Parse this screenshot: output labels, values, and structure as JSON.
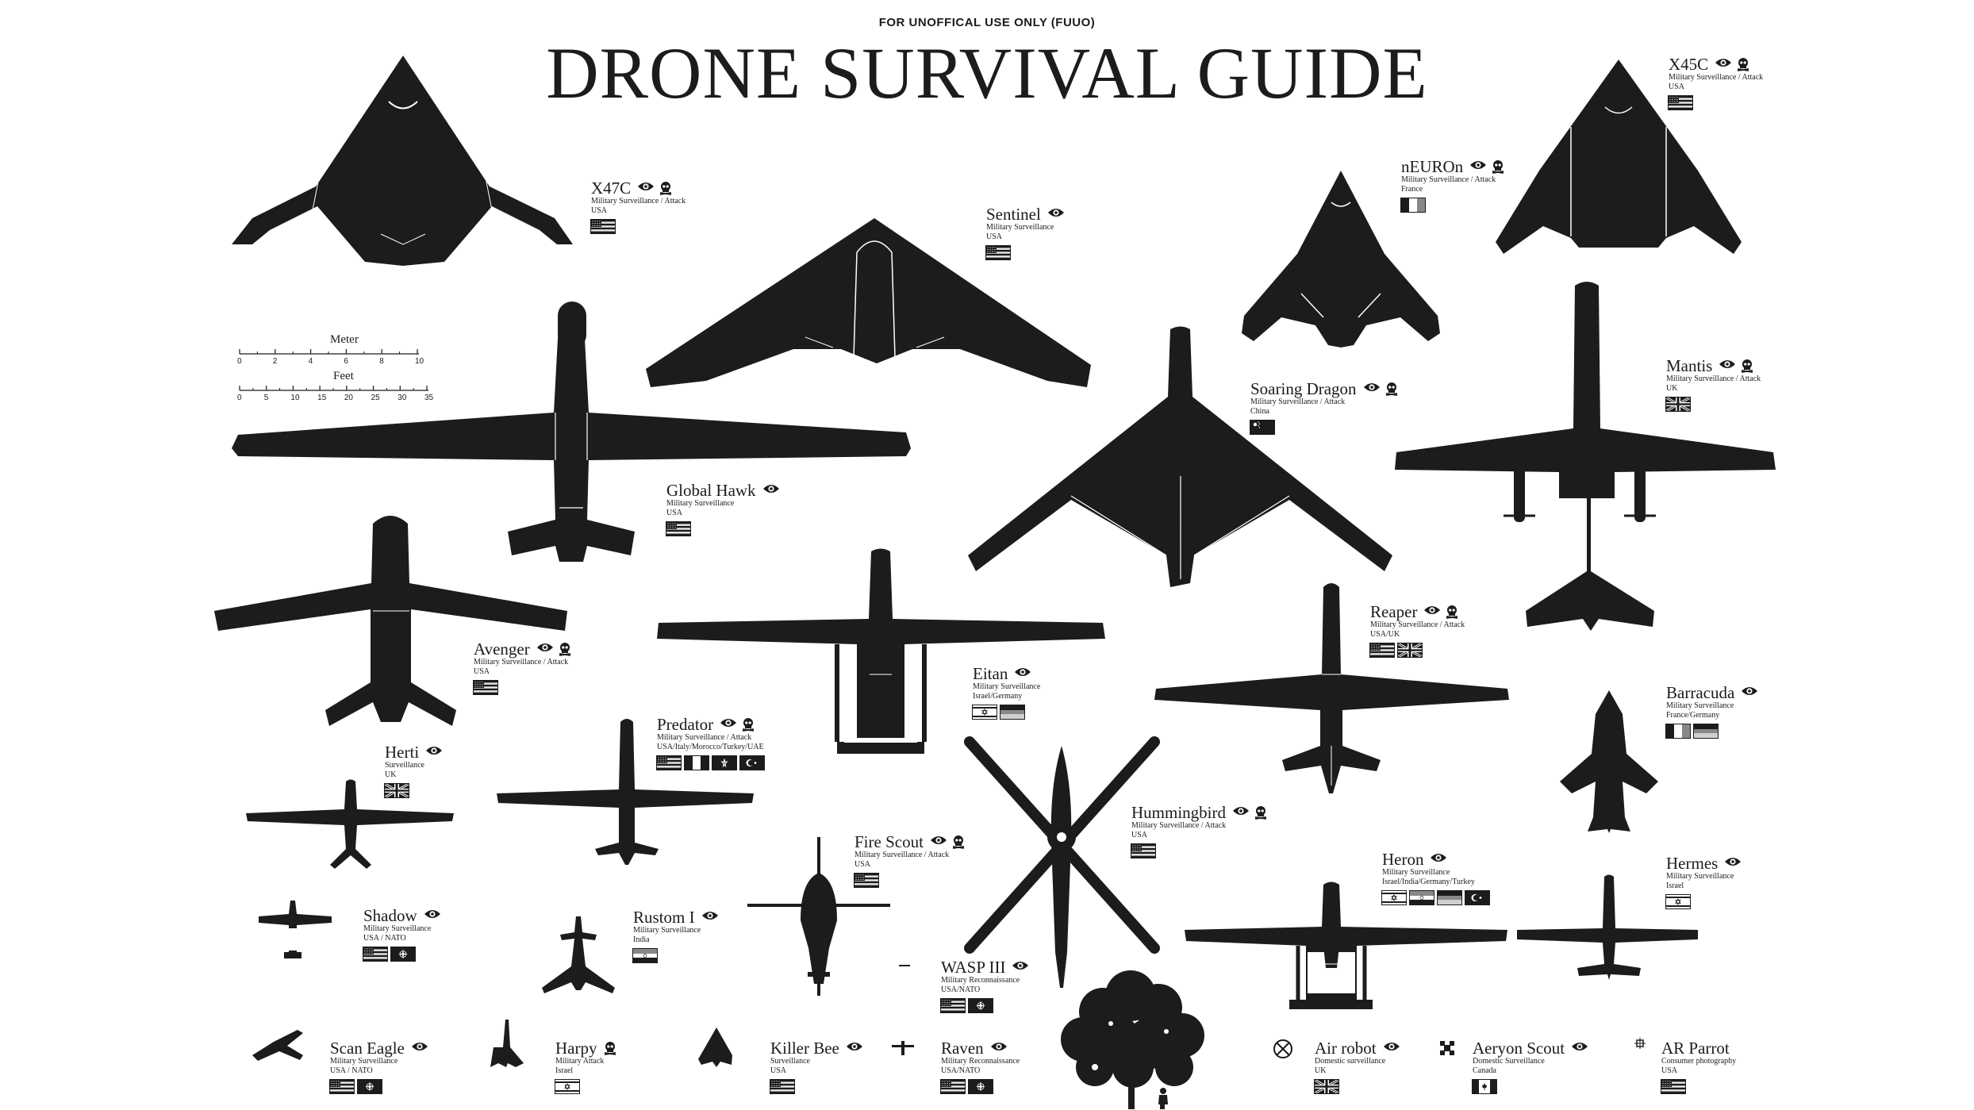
{
  "header": {
    "notice": "FOR UNOFFICAL USE ONLY (FUUO)",
    "title": "DRONE SURVIVAL GUIDE"
  },
  "colors": {
    "ink": "#1d1b1b",
    "paper": "#ffffff"
  },
  "scale": {
    "meter_label": "Meter",
    "meter_ticks": [
      "0",
      "2",
      "4",
      "6",
      "8",
      "10"
    ],
    "feet_label": "Feet",
    "feet_ticks": [
      "0",
      "5",
      "10",
      "15",
      "20",
      "25",
      "30",
      "35"
    ]
  },
  "legend_icons": {
    "surveillance": "eye-icon",
    "attack": "skull-icon"
  },
  "drones": [
    {
      "key": "x47c",
      "name": "X47C",
      "type": "Military Surveillance / Attack",
      "country": "USA",
      "icons": [
        "eye-icon",
        "skull-icon"
      ],
      "flags": [
        "usa"
      ]
    },
    {
      "key": "sentinel",
      "name": "Sentinel",
      "type": "Military Surveillance",
      "country": "USA",
      "icons": [
        "eye-icon"
      ],
      "flags": [
        "usa"
      ]
    },
    {
      "key": "neuron",
      "name": "nEUROn",
      "type": "Military Surveillance / Attack",
      "country": "France",
      "icons": [
        "eye-icon",
        "skull-icon"
      ],
      "flags": [
        "france"
      ]
    },
    {
      "key": "x45c",
      "name": "X45C",
      "type": "Military Surveillance / Attack",
      "country": "USA",
      "icons": [
        "eye-icon",
        "skull-icon"
      ],
      "flags": [
        "usa"
      ]
    },
    {
      "key": "soaringdragon",
      "name": "Soaring Dragon",
      "type": "Military Surveillance / Attack",
      "country": "China",
      "icons": [
        "eye-icon",
        "skull-icon"
      ],
      "flags": [
        "china"
      ]
    },
    {
      "key": "mantis",
      "name": "Mantis",
      "type": "Military Surveillance / Attack",
      "country": "UK",
      "icons": [
        "eye-icon",
        "skull-icon"
      ],
      "flags": [
        "uk"
      ]
    },
    {
      "key": "globalhawk",
      "name": "Global Hawk",
      "type": "Military Surveillance",
      "country": "USA",
      "icons": [
        "eye-icon"
      ],
      "flags": [
        "usa"
      ]
    },
    {
      "key": "reaper",
      "name": "Reaper",
      "type": "Military Surveillance / Attack",
      "country": "USA/UK",
      "icons": [
        "eye-icon",
        "skull-icon"
      ],
      "flags": [
        "usa",
        "uk"
      ]
    },
    {
      "key": "avenger",
      "name": "Avenger",
      "type": "Military Surveillance / Attack",
      "country": "USA",
      "icons": [
        "eye-icon",
        "skull-icon"
      ],
      "flags": [
        "usa"
      ]
    },
    {
      "key": "eitan",
      "name": "Eitan",
      "type": "Military Surveillance",
      "country": "Israel/Germany",
      "icons": [
        "eye-icon"
      ],
      "flags": [
        "israel",
        "germany"
      ]
    },
    {
      "key": "barracuda",
      "name": "Barracuda",
      "type": "Military Surveillance",
      "country": "France/Germany",
      "icons": [
        "eye-icon"
      ],
      "flags": [
        "france",
        "germany"
      ]
    },
    {
      "key": "predator",
      "name": "Predator",
      "type": "Military Surveillance / Attack",
      "country": "USA/Italy/Morocco/Turkey/UAE",
      "icons": [
        "eye-icon",
        "skull-icon"
      ],
      "flags": [
        "usa",
        "italy",
        "morocco",
        "turkey"
      ]
    },
    {
      "key": "herti",
      "name": "Herti",
      "type": "Surveillance",
      "country": "UK",
      "icons": [
        "eye-icon"
      ],
      "flags": [
        "uk"
      ]
    },
    {
      "key": "hummingbird",
      "name": "Hummingbird",
      "type": "Military Surveillance / Attack",
      "country": "USA",
      "icons": [
        "eye-icon",
        "skull-icon"
      ],
      "flags": [
        "usa"
      ]
    },
    {
      "key": "firescout",
      "name": "Fire Scout",
      "type": "Military Surveillance / Attack",
      "country": "USA",
      "icons": [
        "eye-icon",
        "skull-icon"
      ],
      "flags": [
        "usa"
      ]
    },
    {
      "key": "heron",
      "name": "Heron",
      "type": "Military Surveillance",
      "country": "Israel/India/Germany/Turkey",
      "icons": [
        "eye-icon"
      ],
      "flags": [
        "israel",
        "india",
        "germany",
        "turkey"
      ]
    },
    {
      "key": "hermes",
      "name": "Hermes",
      "type": "Military Surveillance",
      "country": "Israel",
      "icons": [
        "eye-icon"
      ],
      "flags": [
        "israel"
      ]
    },
    {
      "key": "shadow",
      "name": "Shadow",
      "type": "Military Surveillance",
      "country": "USA / NATO",
      "icons": [
        "eye-icon"
      ],
      "flags": [
        "usa",
        "nato"
      ]
    },
    {
      "key": "rustom",
      "name": "Rustom I",
      "type": "Military Surveillance",
      "country": "India",
      "icons": [
        "eye-icon"
      ],
      "flags": [
        "india"
      ]
    },
    {
      "key": "wasp",
      "name": "WASP III",
      "type": "Military Reconnaissance",
      "country": "USA/NATO",
      "icons": [
        "eye-icon"
      ],
      "flags": [
        "usa",
        "nato"
      ]
    },
    {
      "key": "scaneagle",
      "name": "Scan Eagle",
      "type": "Military Surveillance",
      "country": "USA / NATO",
      "icons": [
        "eye-icon"
      ],
      "flags": [
        "usa",
        "nato"
      ]
    },
    {
      "key": "harpy",
      "name": "Harpy",
      "type": "Military Attack",
      "country": "Israel",
      "icons": [
        "skull-icon"
      ],
      "flags": [
        "israel"
      ]
    },
    {
      "key": "killerbee",
      "name": "Killer Bee",
      "type": "Surveillance",
      "country": "USA",
      "icons": [
        "eye-icon"
      ],
      "flags": [
        "usa"
      ]
    },
    {
      "key": "raven",
      "name": "Raven",
      "type": "Military Reconnaissance",
      "country": "USA/NATO",
      "icons": [
        "eye-icon"
      ],
      "flags": [
        "usa",
        "nato"
      ]
    },
    {
      "key": "airrobot",
      "name": "Air robot",
      "type": "Domestic surveillance",
      "country": "UK",
      "icons": [
        "eye-icon"
      ],
      "flags": [
        "uk"
      ]
    },
    {
      "key": "aeryon",
      "name": "Aeryon Scout",
      "type": "Domestic Surveillance",
      "country": "Canada",
      "icons": [
        "eye-icon"
      ],
      "flags": [
        "canada"
      ]
    },
    {
      "key": "arparrot",
      "name": "AR Parrot",
      "type": "Consumer photography",
      "country": "USA",
      "icons": [],
      "flags": [
        "usa"
      ]
    }
  ]
}
